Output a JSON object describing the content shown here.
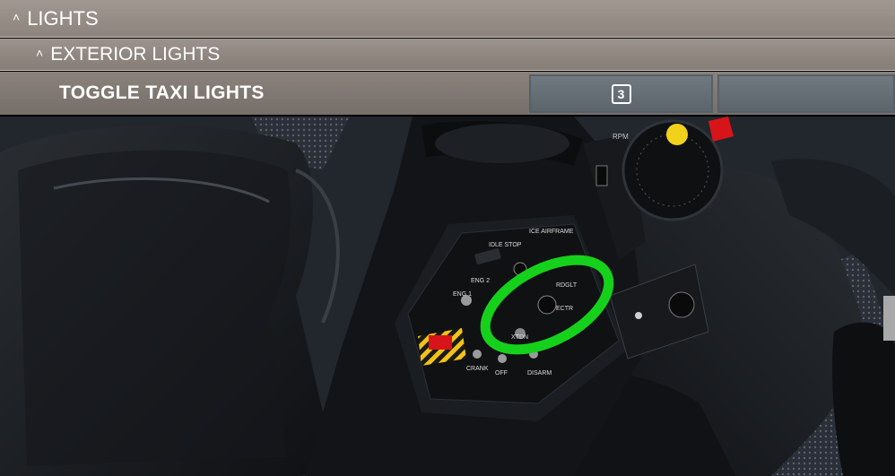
{
  "menu": {
    "lights_label": "LIGHTS",
    "exterior_label": "EXTERIOR LIGHTS",
    "action_label": "TOGGLE TAXI LIGHTS",
    "binding_slot1_key": "3",
    "binding_slot2_key": ""
  },
  "panel_labels": {
    "idle_stop": "IDLE STOP",
    "eng1": "ENG 1",
    "eng2": "ENG 2",
    "ice_airframe": "ICE AIRFRAME",
    "rdglt": "RDGLT",
    "ectr": "ECTR",
    "xtdn": "XTDN",
    "crank": "CRANK",
    "off": "OFF",
    "disarm": "DISARM",
    "rpm": "RPM"
  },
  "colors": {
    "highlight": "#16d11c",
    "guard_stripe": "#f2c316",
    "guarded_switch": "#d8141b",
    "yellow_knob": "#f1d21b"
  }
}
